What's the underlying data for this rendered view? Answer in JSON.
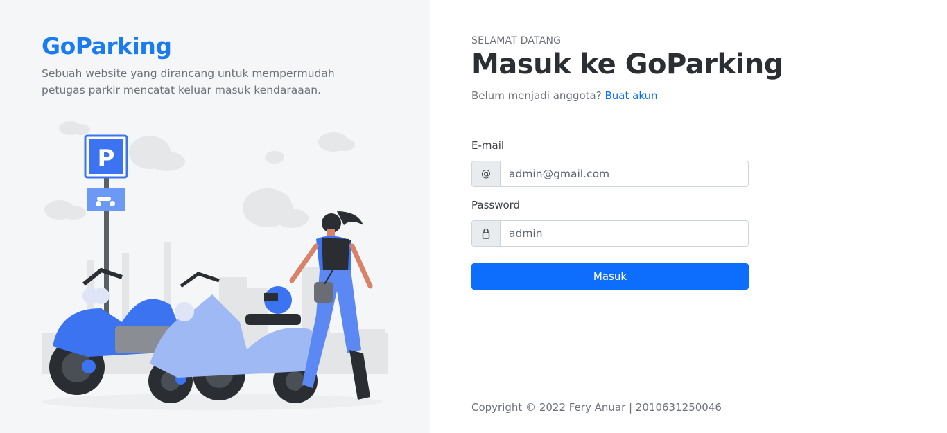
{
  "brand": {
    "name": "GoParking",
    "tagline": "Sebuah website yang dirancang untuk mempermudah petugas parkir mencatat keluar masuk kendaraaan."
  },
  "illustration": {
    "sign_letter": "P",
    "description_icon": "motorbike-parking-illustration"
  },
  "login": {
    "eyebrow": "SELAMAT DATANG",
    "title": "Masuk ke GoParking",
    "signup_prompt": "Belum menjadi anggota?",
    "signup_link": "Buat akun",
    "email_label": "E-mail",
    "email_addon": "@",
    "email_value": "admin@gmail.com",
    "password_label": "Password",
    "password_icon": "lock-icon",
    "password_value": "admin",
    "submit_label": "Masuk"
  },
  "footer": {
    "copyright": "Copyright © 2022 Fery Anuar | 2010631250046"
  },
  "colors": {
    "primary": "#0d6efd",
    "brand": "#1a7cf0",
    "left_panel_bg": "#f5f6f7"
  }
}
